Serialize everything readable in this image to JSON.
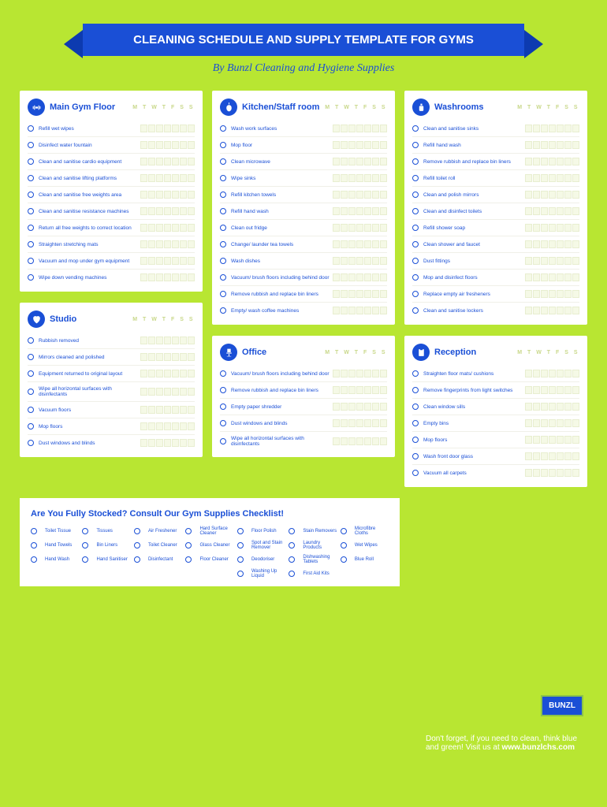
{
  "header": {
    "title": "CLEANING SCHEDULE AND SUPPLY TEMPLATE FOR GYMS",
    "subtitle": "By Bunzl Cleaning and Hygiene Supplies"
  },
  "days": "M T W T F S S",
  "sections": {
    "main_gym": {
      "title": "Main Gym Floor",
      "tasks": [
        "Refill wet wipes",
        "Disinfect water fountain",
        "Clean and sanitise cardio equipment",
        "Clean and sanitise lifting platforms",
        "Clean and sanitise free weights area",
        "Clean and sanitise resistance machines",
        "Return all free weights to correct location",
        "Straighten stretching mats",
        "Vacuum and mop under gym equipment",
        "Wipe down vending machines"
      ]
    },
    "studio": {
      "title": "Studio",
      "tasks": [
        "Rubbish removed",
        "Mirrors cleaned and polished",
        "Equipment returned to original layout",
        "Wipe all horizontal surfaces with disinfectants",
        "Vacuum floors",
        "Mop floors",
        "Dust windows and blinds"
      ]
    },
    "kitchen": {
      "title": "Kitchen/Staff room",
      "tasks": [
        "Wash work surfaces",
        "Mop floor",
        "Clean microwave",
        "Wipe sinks",
        "Refill kitchen towels",
        "Refill hand wash",
        "Clean out fridge",
        "Change/ launder tea towels",
        "Wash dishes",
        "Vacuum/ brush floors including behind door",
        "Remove rubbish and replace bin liners",
        "Empty/ wash coffee machines"
      ]
    },
    "office": {
      "title": "Office",
      "tasks": [
        "Vacuum/ brush floors including behind door",
        "Remove rubbish and replace bin liners",
        "Empty paper shredder",
        "Dust windows and blinds",
        "Wipe all horizontal surfaces with disinfectants"
      ]
    },
    "washrooms": {
      "title": "Washrooms",
      "tasks": [
        "Clean and sanitise sinks",
        "Refill hand wash",
        "Remove rubbish and replace bin liners",
        "Refill toilet roll",
        "Clean and polish mirrors",
        "Clean and disinfect toilets",
        "Refill shower soap",
        "Clean shower and faucet",
        "Dust fittings",
        "Mop and disinfect floors",
        "Replace empty air fresheners",
        "Clean and sanitise lockers"
      ]
    },
    "reception": {
      "title": "Reception",
      "tasks": [
        "Straighten floor mats/ cushions",
        "Remove fingerprints from light switches",
        "Clean window sills",
        "Empty bins",
        "Mop floors",
        "Wash front door glass",
        "Vacuum all carpets"
      ]
    }
  },
  "stocked": {
    "title": "Are You Fully Stocked? Consult Our Gym Supplies Checklist!",
    "items": [
      "Toilet Tissue",
      "Tissues",
      "Air Freshener",
      "Hard Surface Cleaner",
      "Floor Polish",
      "Stain Removers",
      "Microfibre Cloths",
      "Hand Towels",
      "Bin Liners",
      "Toilet Cleaner",
      "Glass Cleaner",
      "Spot and Stain Remover",
      "Laundry Products",
      "Wet Wipes",
      "Hand Wash",
      "Hand Sanitiser",
      "Disinfectant",
      "Floor Cleaner",
      "Deodoriser",
      "Dishwashing Tablets",
      "Blue Roll",
      "",
      "",
      "",
      "",
      "Washing Up Liquid",
      "First Aid Kits"
    ]
  },
  "footer": {
    "text1": "Don't forget, if you need to clean, think blue",
    "text2": "and green! Visit us at ",
    "url": "www.bunzlchs.com"
  },
  "logo": "BUNZL"
}
